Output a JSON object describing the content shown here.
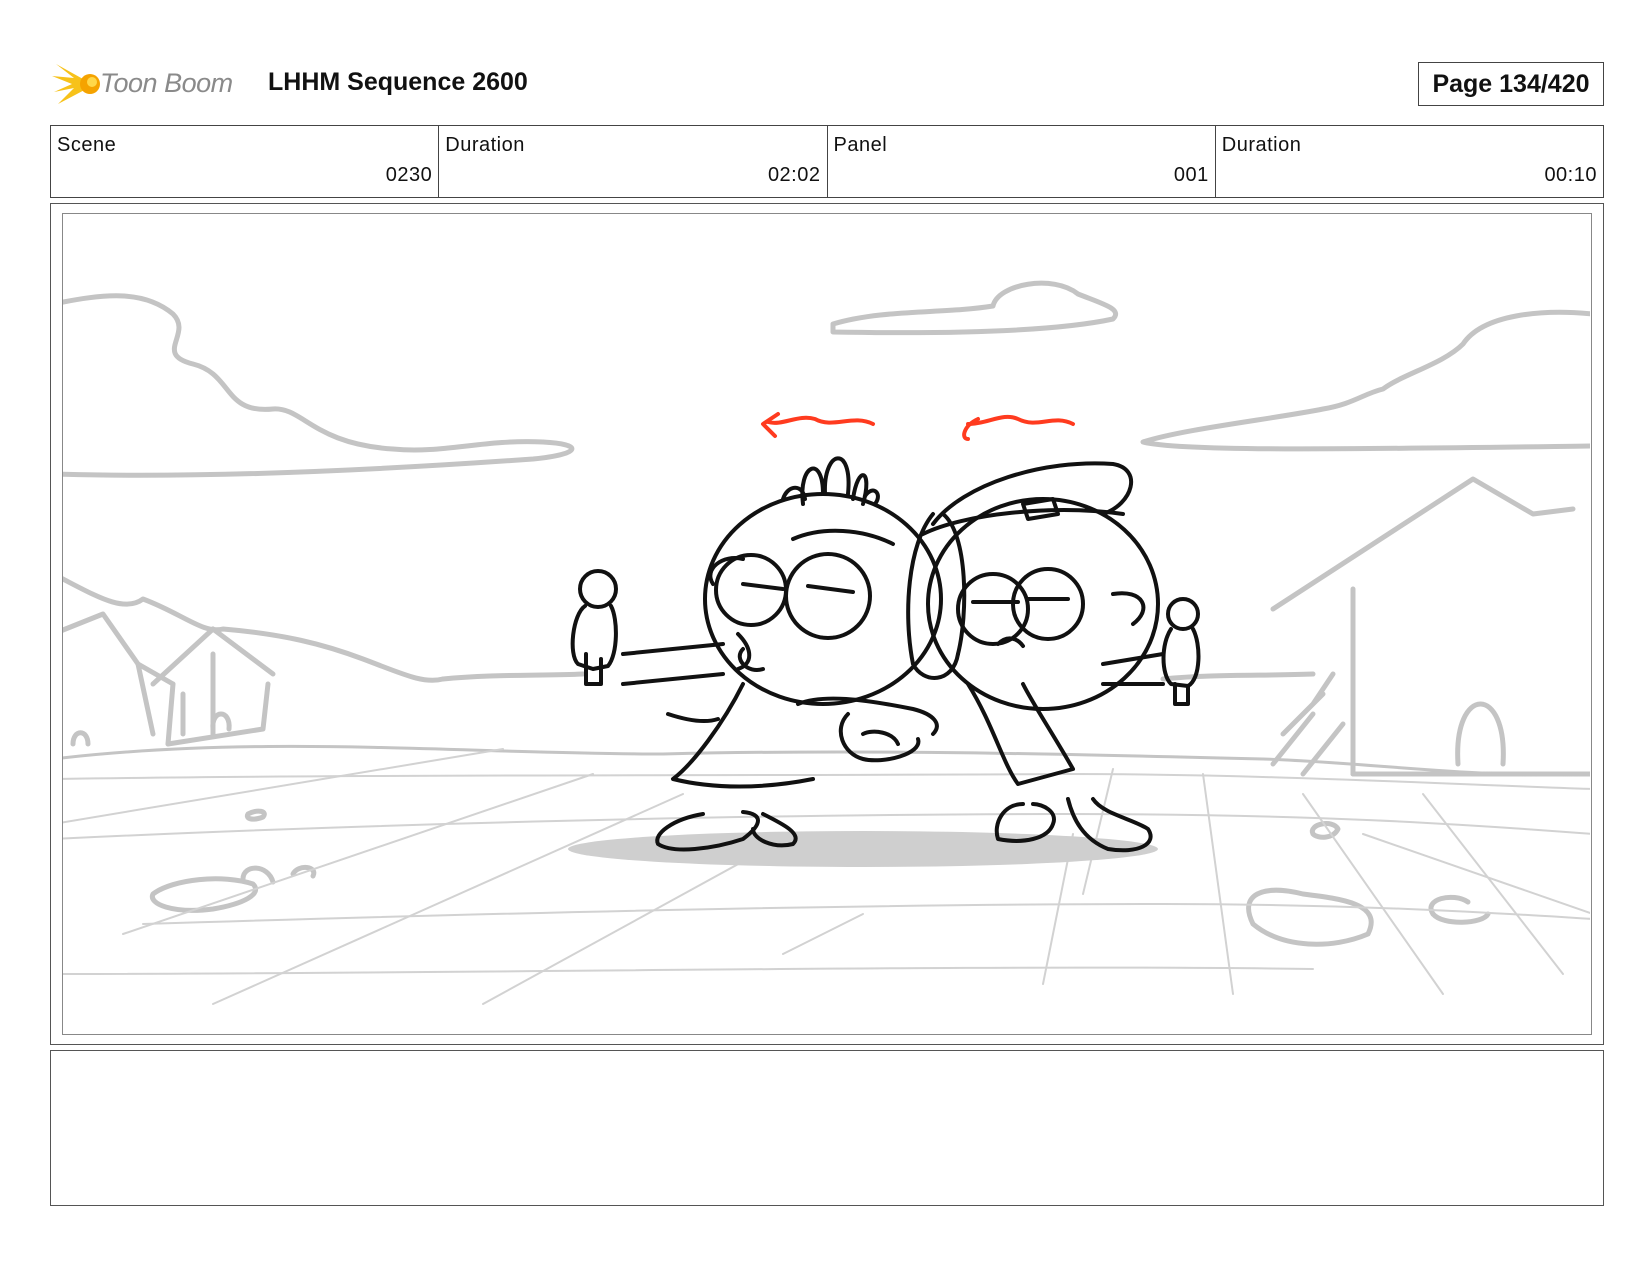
{
  "header": {
    "logo_text": "Toon Boom",
    "logo_icon": "toon-boom-burst-icon",
    "title": "LHHM Sequence 2600",
    "page_label": "Page 134/420"
  },
  "info": [
    {
      "label": "Scene",
      "value": "0230"
    },
    {
      "label": "Duration",
      "value": "02:02"
    },
    {
      "label": "Panel",
      "value": "001"
    },
    {
      "label": "Duration",
      "value": "00:10"
    }
  ],
  "panel": {
    "image": "storyboard-sketch-two-characters-hugging-in-plaza",
    "accent_color": "#ff3b1f"
  },
  "notes": ""
}
